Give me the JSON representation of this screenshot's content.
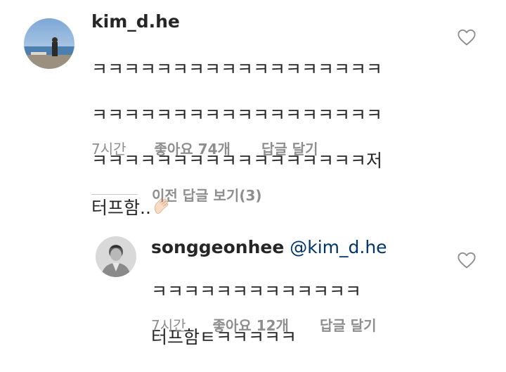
{
  "comments": [
    {
      "username": "kim_d.he",
      "lines": [
        "ㅋㅋㅋㅋㅋㅋㅋㅋㅋㅋㅋㅋㅋㅋㅋㅋㅋㅋ",
        "ㅋㅋㅋㅋㅋㅋㅋㅋㅋㅋㅋㅋㅋㅋㅋㅋㅋㅋ",
        "ㅋㅋㅋㅋㅋㅋㅋㅋㅋㅋㅋㅋㅋㅋㅋㅋㅋ저",
        "터프함.."
      ],
      "emoji": "clapping-hands",
      "time": "7시간",
      "likes": "좋아요 74개",
      "reply": "답글 달기"
    },
    {
      "username": "songgeonhee",
      "mention": "@kim_d.he",
      "lines": [
        "ㅋㅋㅋㅋㅋㅋㅋㅋㅋㅋㅋㅋㅋ",
        "터프함ㅌㅋㅋㅋㅋㅋ"
      ],
      "time": "7시간",
      "likes": "좋아요 12개",
      "reply": "답글 달기"
    }
  ],
  "view_replies": {
    "label": "이전 답글 보기(3)"
  },
  "icons": {
    "like": "heart-outline-icon",
    "emoji": "clapping-hands-icon"
  },
  "colors": {
    "text": "#262626",
    "muted": "#8e8e8e",
    "mention": "#003569"
  }
}
